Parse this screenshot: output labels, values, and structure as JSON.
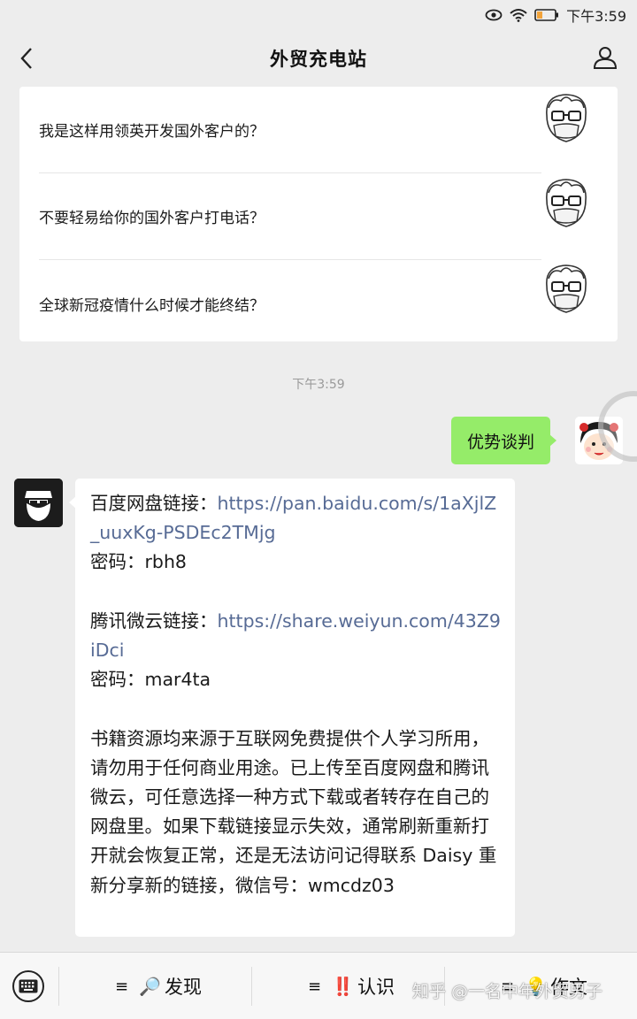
{
  "status": {
    "time": "下午3:59"
  },
  "nav": {
    "title": "外贸充电站"
  },
  "articles": [
    {
      "title": "我是这样用领英开发国外客户的？"
    },
    {
      "title": "不要轻易给你的国外客户打电话？"
    },
    {
      "title": "全球新冠疫情什么时候才能终结？"
    }
  ],
  "chat": {
    "timestamp": "下午3:59",
    "sent_message": "优势谈判",
    "reply": {
      "baidu_label": "百度网盘链接：",
      "baidu_link": "https://pan.baidu.com/s/1aXjlZ_uuxKg-PSDEc2TMjg",
      "baidu_pwd": "密码：rbh8",
      "weiyun_label": "腾讯微云链接：",
      "weiyun_link": "https://share.weiyun.com/43Z9iDci",
      "weiyun_pwd": "密码：mar4ta",
      "notice": "书籍资源均来源于互联网免费提供个人学习所用，请勿用于任何商业用途。已上传至百度网盘和腾讯微云，可任意选择一种方式下载或者转存在自己的网盘里。如果下载链接显示失效，通常刷新重新打开就会恢复正常，还是无法访问记得联系 Daisy 重新分享新的链接，微信号：wmcdz03"
    }
  },
  "menu": {
    "tabs": [
      {
        "ham": "≡",
        "emoji": "🔎",
        "label": "发现"
      },
      {
        "ham": "≡",
        "emoji": "‼️",
        "label": "认识"
      },
      {
        "ham": "≡",
        "emoji": "💡",
        "label": "作文"
      }
    ]
  },
  "watermark": "知乎 @一名中年外贸男子",
  "colors": {
    "background": "#ededed",
    "sent_bubble": "#95ec69",
    "link": "#576b95"
  }
}
